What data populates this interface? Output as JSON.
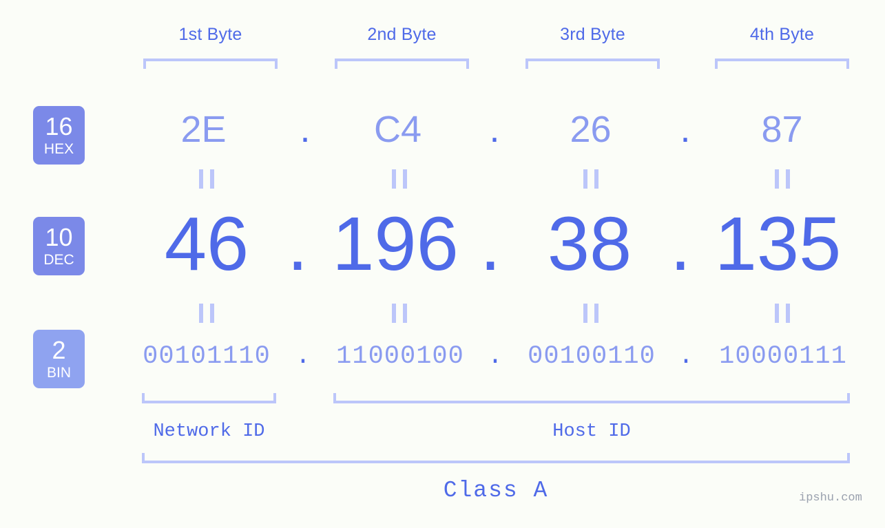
{
  "diagram": {
    "ip_decimal": "46.196.38.135",
    "ip_class": "Class A",
    "watermark": "ipshu.com",
    "colors": {
      "background": "#fbfdf8",
      "strong_blue": "#4f6ae8",
      "medium_blue": "#8a9bf0",
      "light_lavender": "#bcc6fa",
      "badge_blue": "#7b89e8",
      "badge_blue_light": "#8fa3f0"
    }
  },
  "byte_headers": [
    {
      "label": "1st Byte"
    },
    {
      "label": "2nd Byte"
    },
    {
      "label": "3rd Byte"
    },
    {
      "label": "4th Byte"
    }
  ],
  "rows": {
    "hex": {
      "badge_num": "16",
      "badge_name": "HEX",
      "values": [
        "2E",
        "C4",
        "26",
        "87"
      ],
      "separator": "."
    },
    "dec": {
      "badge_num": "10",
      "badge_name": "DEC",
      "values": [
        "46",
        "196",
        "38",
        "135"
      ],
      "separator": "."
    },
    "bin": {
      "badge_num": "2",
      "badge_name": "BIN",
      "values": [
        "00101110",
        "11000100",
        "00100110",
        "10000111"
      ],
      "separator": "."
    }
  },
  "equals_marks": {
    "glyph": "||",
    "count_per_row": 4
  },
  "footer": {
    "network_id_label": "Network ID",
    "host_id_label": "Host ID",
    "class_label": "Class A"
  }
}
